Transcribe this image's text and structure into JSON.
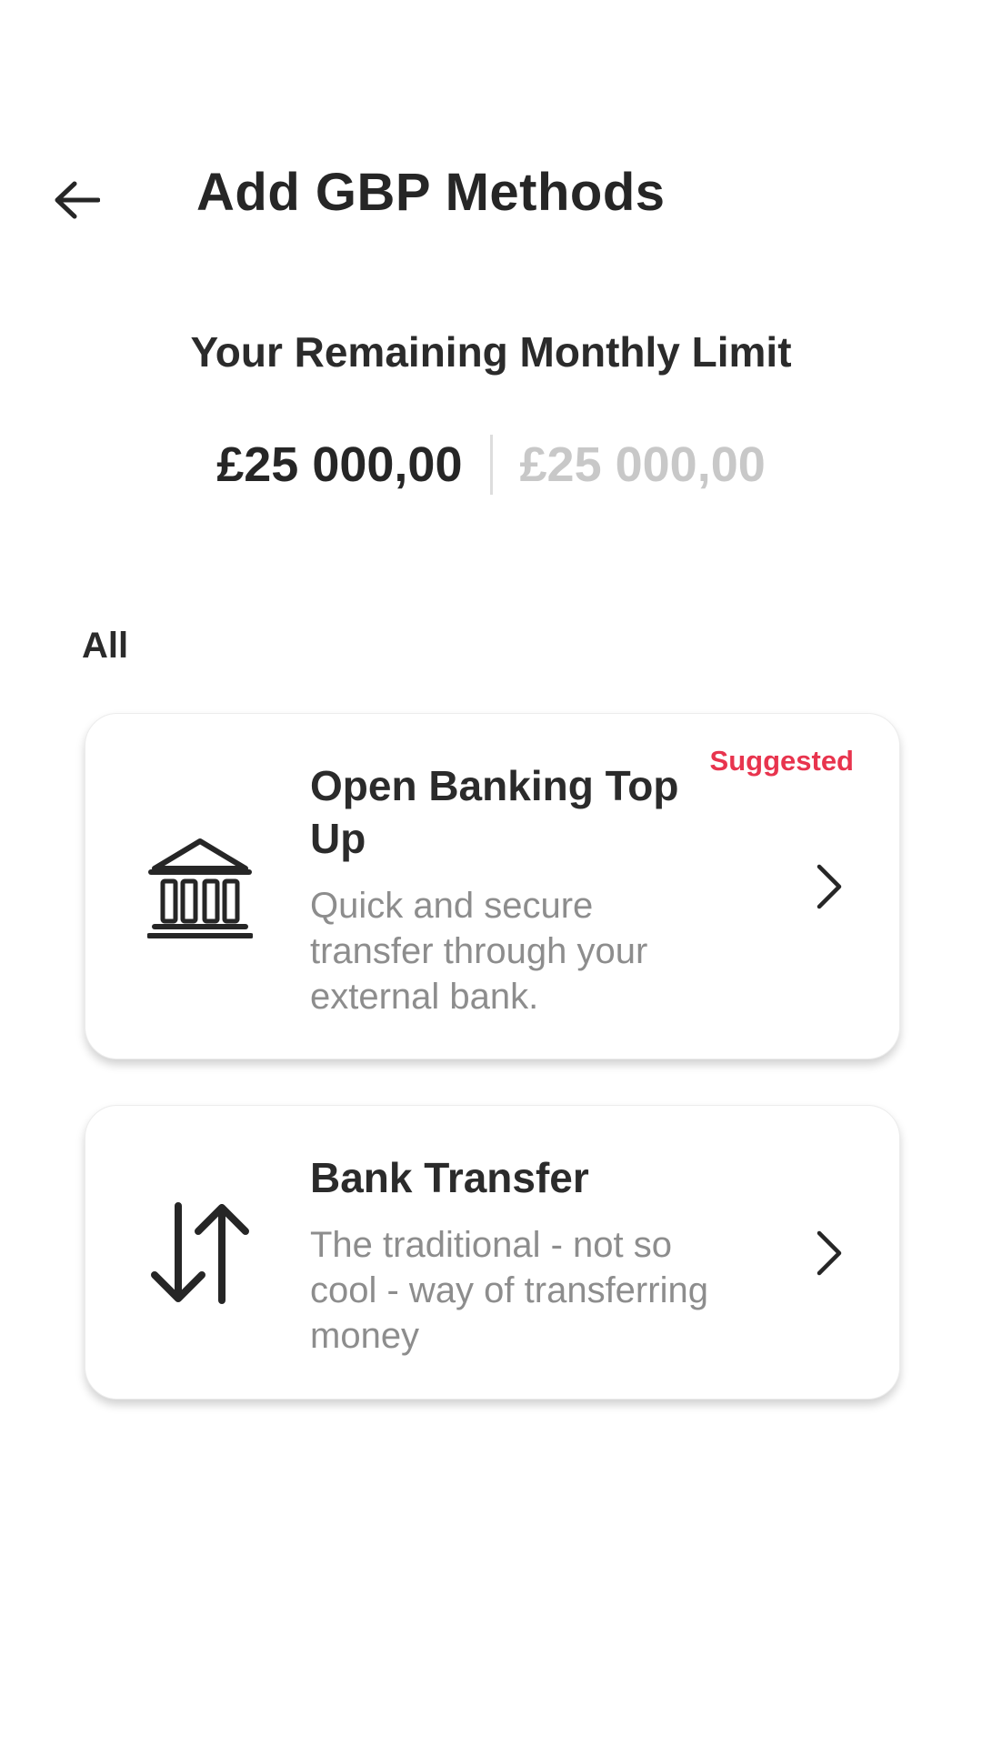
{
  "header": {
    "title": "Add GBP Methods",
    "back_icon": "arrow-left-icon"
  },
  "limit": {
    "label": "Your Remaining Monthly Limit",
    "remaining": "£25 000,00",
    "total": "£25 000,00"
  },
  "section": {
    "label": "All"
  },
  "methods": [
    {
      "title": "Open Banking Top Up",
      "description": "Quick and secure transfer through your external bank.",
      "badge": "Suggested",
      "icon": "bank-icon"
    },
    {
      "title": "Bank Transfer",
      "description": "The traditional - not so cool - way of transferring money",
      "icon": "transfer-arrows-icon"
    }
  ],
  "colors": {
    "accent": "#e8344e",
    "text": "#2b2b2b",
    "muted": "#8d8d8d",
    "disabled_amount": "#c8c8c8"
  }
}
